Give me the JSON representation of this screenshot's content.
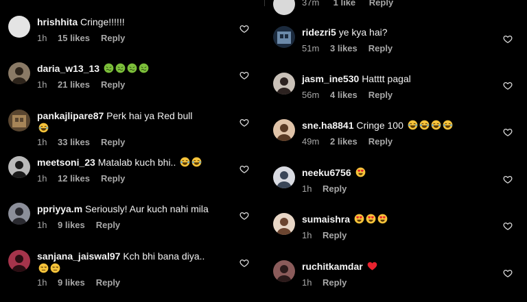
{
  "left_comments": [
    {
      "username": "hrishhita",
      "text": "Cringe!!!!!!",
      "time": "1h",
      "likes": "15 likes",
      "reply": "Reply",
      "emojis": []
    },
    {
      "username": "daria_w13_13",
      "text": "",
      "time": "1h",
      "likes": "21 likes",
      "reply": "Reply",
      "emojis": [
        "nauseated",
        "nauseated",
        "nauseated",
        "nauseated"
      ]
    },
    {
      "username": "pankajlipare87",
      "text": "Perk hai ya Red bull",
      "time": "1h",
      "likes": "33 likes",
      "reply": "Reply",
      "emojis": [
        "joy"
      ]
    },
    {
      "username": "meetsoni_23",
      "text": "Matalab kuch bhi..",
      "time": "1h",
      "likes": "12 likes",
      "reply": "Reply",
      "emojis": [
        "joy",
        "joy"
      ]
    },
    {
      "username": "ppriyya.m",
      "text": "Seriously! Aur kuch nahi mila",
      "time": "1h",
      "likes": "9 likes",
      "reply": "Reply",
      "emojis": []
    },
    {
      "username": "sanjana_jaiswal97",
      "text": "Kch bhi bana diya..",
      "time": "1h",
      "likes": "9 likes",
      "reply": "Reply",
      "emojis": [
        "unamused",
        "unamused"
      ]
    }
  ],
  "right_top_partial": {
    "time": "37m",
    "likes": "1 like",
    "reply": "Reply"
  },
  "right_comments": [
    {
      "username": "ridezri5",
      "text": "ye kya hai?",
      "time": "51m",
      "likes": "3 likes",
      "reply": "Reply",
      "emojis": []
    },
    {
      "username": "jasm_ine530",
      "text": "Hatttt pagal",
      "time": "56m",
      "likes": "4 likes",
      "reply": "Reply",
      "emojis": []
    },
    {
      "username": "sne.ha8841",
      "text": "Cringe 100",
      "time": "49m",
      "likes": "2 likes",
      "reply": "Reply",
      "emojis": [
        "joy",
        "joy",
        "joy",
        "joy"
      ]
    },
    {
      "username": "neeku6756",
      "text": "",
      "time": "1h",
      "likes": "",
      "reply": "Reply",
      "emojis": [
        "heart-eyes"
      ]
    },
    {
      "username": "sumaishra",
      "text": "",
      "time": "1h",
      "likes": "",
      "reply": "Reply",
      "emojis": [
        "heart-eyes",
        "heart-eyes",
        "heart-eyes"
      ]
    },
    {
      "username": "ruchitkamdar",
      "text": "",
      "time": "1h",
      "likes": "",
      "reply": "Reply",
      "emojis": [
        "red-heart"
      ]
    }
  ],
  "icons": {
    "like": "heart-outline-icon"
  },
  "colors": {
    "background": "#000000",
    "text": "#f5f5f5",
    "meta": "#a8a8a8"
  }
}
